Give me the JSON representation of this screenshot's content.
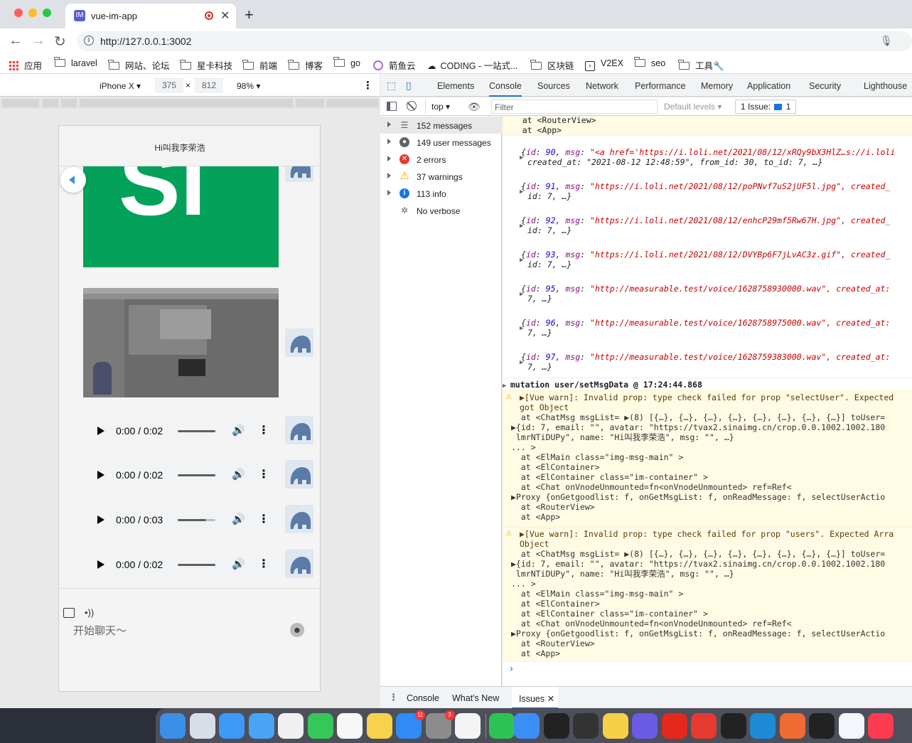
{
  "browser": {
    "tab_title": "vue-im-app",
    "tab_favicon": "IM",
    "url": "http://127.0.0.1:3002",
    "bookmarks": [
      {
        "label": "应用",
        "icon": "apps-grid-icon"
      },
      {
        "label": "laravel",
        "icon": "folder-icon"
      },
      {
        "label": "网站、论坛",
        "icon": "folder-icon"
      },
      {
        "label": "星卡科技",
        "icon": "folder-icon"
      },
      {
        "label": "前端",
        "icon": "folder-icon"
      },
      {
        "label": "博客",
        "icon": "folder-icon"
      },
      {
        "label": "go",
        "icon": "folder-icon"
      },
      {
        "label": "箭鱼云",
        "icon": "site-icon"
      },
      {
        "label": "CODING - 一站式...",
        "icon": "site-icon"
      },
      {
        "label": "区块链",
        "icon": "folder-icon"
      },
      {
        "label": "V2EX",
        "icon": "site-icon"
      },
      {
        "label": "seo",
        "icon": "folder-icon"
      },
      {
        "label": "工具🔧",
        "icon": "folder-icon"
      }
    ]
  },
  "device_toolbar": {
    "device": "iPhone X",
    "width": "375",
    "height": "812",
    "zoom": "98%"
  },
  "chat": {
    "header_title": "Hi叫我李荣浩",
    "audio_messages": [
      {
        "time": "0:00 / 0:02",
        "progress": 1.0
      },
      {
        "time": "0:00 / 0:02",
        "progress": 1.0
      },
      {
        "time": "0:00 / 0:03",
        "progress": 0.75
      },
      {
        "time": "0:00 / 0:02",
        "progress": 1.0
      }
    ],
    "input_placeholder": "开始聊天～",
    "image_text": "SI"
  },
  "devtools": {
    "tabs": [
      "Elements",
      "Console",
      "Sources",
      "Network",
      "Performance",
      "Memory",
      "Application",
      "Security",
      "Lighthouse"
    ],
    "active_tab": "Console",
    "context": "top",
    "filter_placeholder": "Filter",
    "levels": "Default levels",
    "issues": "1 Issue:",
    "issues_count": "1",
    "sidebar": [
      {
        "label": "152 messages",
        "icon": "list-icon",
        "color": "#5f6368"
      },
      {
        "label": "149 user messages",
        "icon": "user-icon",
        "color": "#5f6368"
      },
      {
        "label": "2 errors",
        "icon": "error-icon",
        "color": "#e33b2e"
      },
      {
        "label": "37 warnings",
        "icon": "warning-icon",
        "color": "#f2a600"
      },
      {
        "label": "113 info",
        "icon": "info-icon",
        "color": "#1a73e8"
      },
      {
        "label": "No verbose",
        "icon": "bug-icon",
        "color": "#5f6368"
      }
    ],
    "drawer_tabs": [
      "Console",
      "What's New",
      "Issues"
    ],
    "drawer_active": "Issues"
  },
  "console": {
    "top_lines": [
      "at <RouterView>",
      "at <App>"
    ],
    "objects": [
      {
        "id": "90",
        "msg": "\"<a href='https://i.loli.net/2021/08/12/xRQy9bX3HlZ…s://i.loli",
        "line2": "created_at: \"2021-08-12 12:48:59\", from_id: 30, to_id: 7, …}"
      },
      {
        "id": "91",
        "msg": "\"https://i.loli.net/2021/08/12/poPNvf7uS2jUF5l.jpg\", created_",
        "line2": "id: 7, …}"
      },
      {
        "id": "92",
        "msg": "\"https://i.loli.net/2021/08/12/enhcP29mf5Rw67H.jpg\", created_",
        "line2": "id: 7, …}"
      },
      {
        "id": "93",
        "msg": "\"https://i.loli.net/2021/08/12/DVYBp6F7jLvAC3z.gif\", created_",
        "line2": "id: 7, …}"
      },
      {
        "id": "95",
        "msg": "\"http://measurable.test/voice/1628758930000.wav\", created_at:",
        "line2": "7, …}"
      },
      {
        "id": "96",
        "msg": "\"http://measurable.test/voice/1628758975000.wav\", created_at:",
        "line2": "7, …}"
      },
      {
        "id": "97",
        "msg": "\"http://measurable.test/voice/1628759383000.wav\", created_at:",
        "line2": "7, …}"
      }
    ],
    "mutation": "mutation user/setMsgData @ 17:24:44.868",
    "warnings": [
      {
        "head": "▶[Vue warn]: Invalid prop: type check failed for prop \"selectUser\". Expected",
        "head2": "got Object"
      },
      {
        "head": "▶[Vue warn]: Invalid prop: type check failed for prop \"users\". Expected Arra",
        "head2": "Object"
      }
    ],
    "warn_body": [
      "  at <ChatMsg msgList= ▶(8) [{…}, {…}, {…}, {…}, {…}, {…}, {…}, {…}] toUser=",
      "▶{id: 7, email: \"\", avatar: \"https://tvax2.sinaimg.cn/crop.0.0.1002.1002.180",
      " lmrNTiDUPy\", name: \"Hi叫我李荣浩\", msg: \"\", …}",
      "... >",
      "  at <ElMain class=\"img-msg-main\" >",
      "  at <ElContainer>",
      "  at <ElContainer class=\"im-container\" >",
      "  at <Chat onVnodeUnmounted=fn<onVnodeUnmounted> ref=Ref<",
      "▶Proxy {onGetgoodlist: f, onGetMsgList: f, onReadMessage: f, selectUserActio",
      "  at <RouterView>",
      "  at <App>"
    ],
    "prompt": "›"
  },
  "dock": {
    "apps": [
      {
        "name": "finder-icon",
        "color": "#3b8fe8"
      },
      {
        "name": "launchpad-icon",
        "color": "#d9dde6"
      },
      {
        "name": "safari-icon",
        "color": "#3a9af5"
      },
      {
        "name": "mail-icon",
        "color": "#4aa3f5"
      },
      {
        "name": "photos-icon",
        "color": "#f0f0f0"
      },
      {
        "name": "messages-icon",
        "color": "#35c759"
      },
      {
        "name": "reminders-icon",
        "color": "#f7f7f7"
      },
      {
        "name": "notes-icon",
        "color": "#f7d24a"
      },
      {
        "name": "app-store-icon",
        "color": "#2f8bf5",
        "badge": "11"
      },
      {
        "name": "system-preferences-icon",
        "color": "#8c8c8c",
        "badge": "3"
      },
      {
        "name": "chrome-icon",
        "color": "#f4f4f4"
      },
      {
        "name": "wechat-icon",
        "color": "#2ec255"
      },
      {
        "name": "paper-plane-icon",
        "color": "#3b8ef5"
      },
      {
        "name": "terminal-icon",
        "color": "#222"
      },
      {
        "name": "zen-terminal-icon",
        "color": "#333"
      },
      {
        "name": "qq-music-icon",
        "color": "#f6d046"
      },
      {
        "name": "creative-icon",
        "color": "#6a5be2"
      },
      {
        "name": "youdao-icon",
        "color": "#e5281e"
      },
      {
        "name": "wps-icon",
        "color": "#e63a30"
      },
      {
        "name": "goland-icon",
        "color": "#222"
      },
      {
        "name": "vscode-icon",
        "color": "#1e8ad6"
      },
      {
        "name": "postman-icon",
        "color": "#f06a34"
      },
      {
        "name": "phpstorm-icon",
        "color": "#222"
      },
      {
        "name": "baidu-netdisk-icon",
        "color": "#f4f6fb"
      },
      {
        "name": "music-icon",
        "color": "#fa3b50"
      }
    ]
  }
}
